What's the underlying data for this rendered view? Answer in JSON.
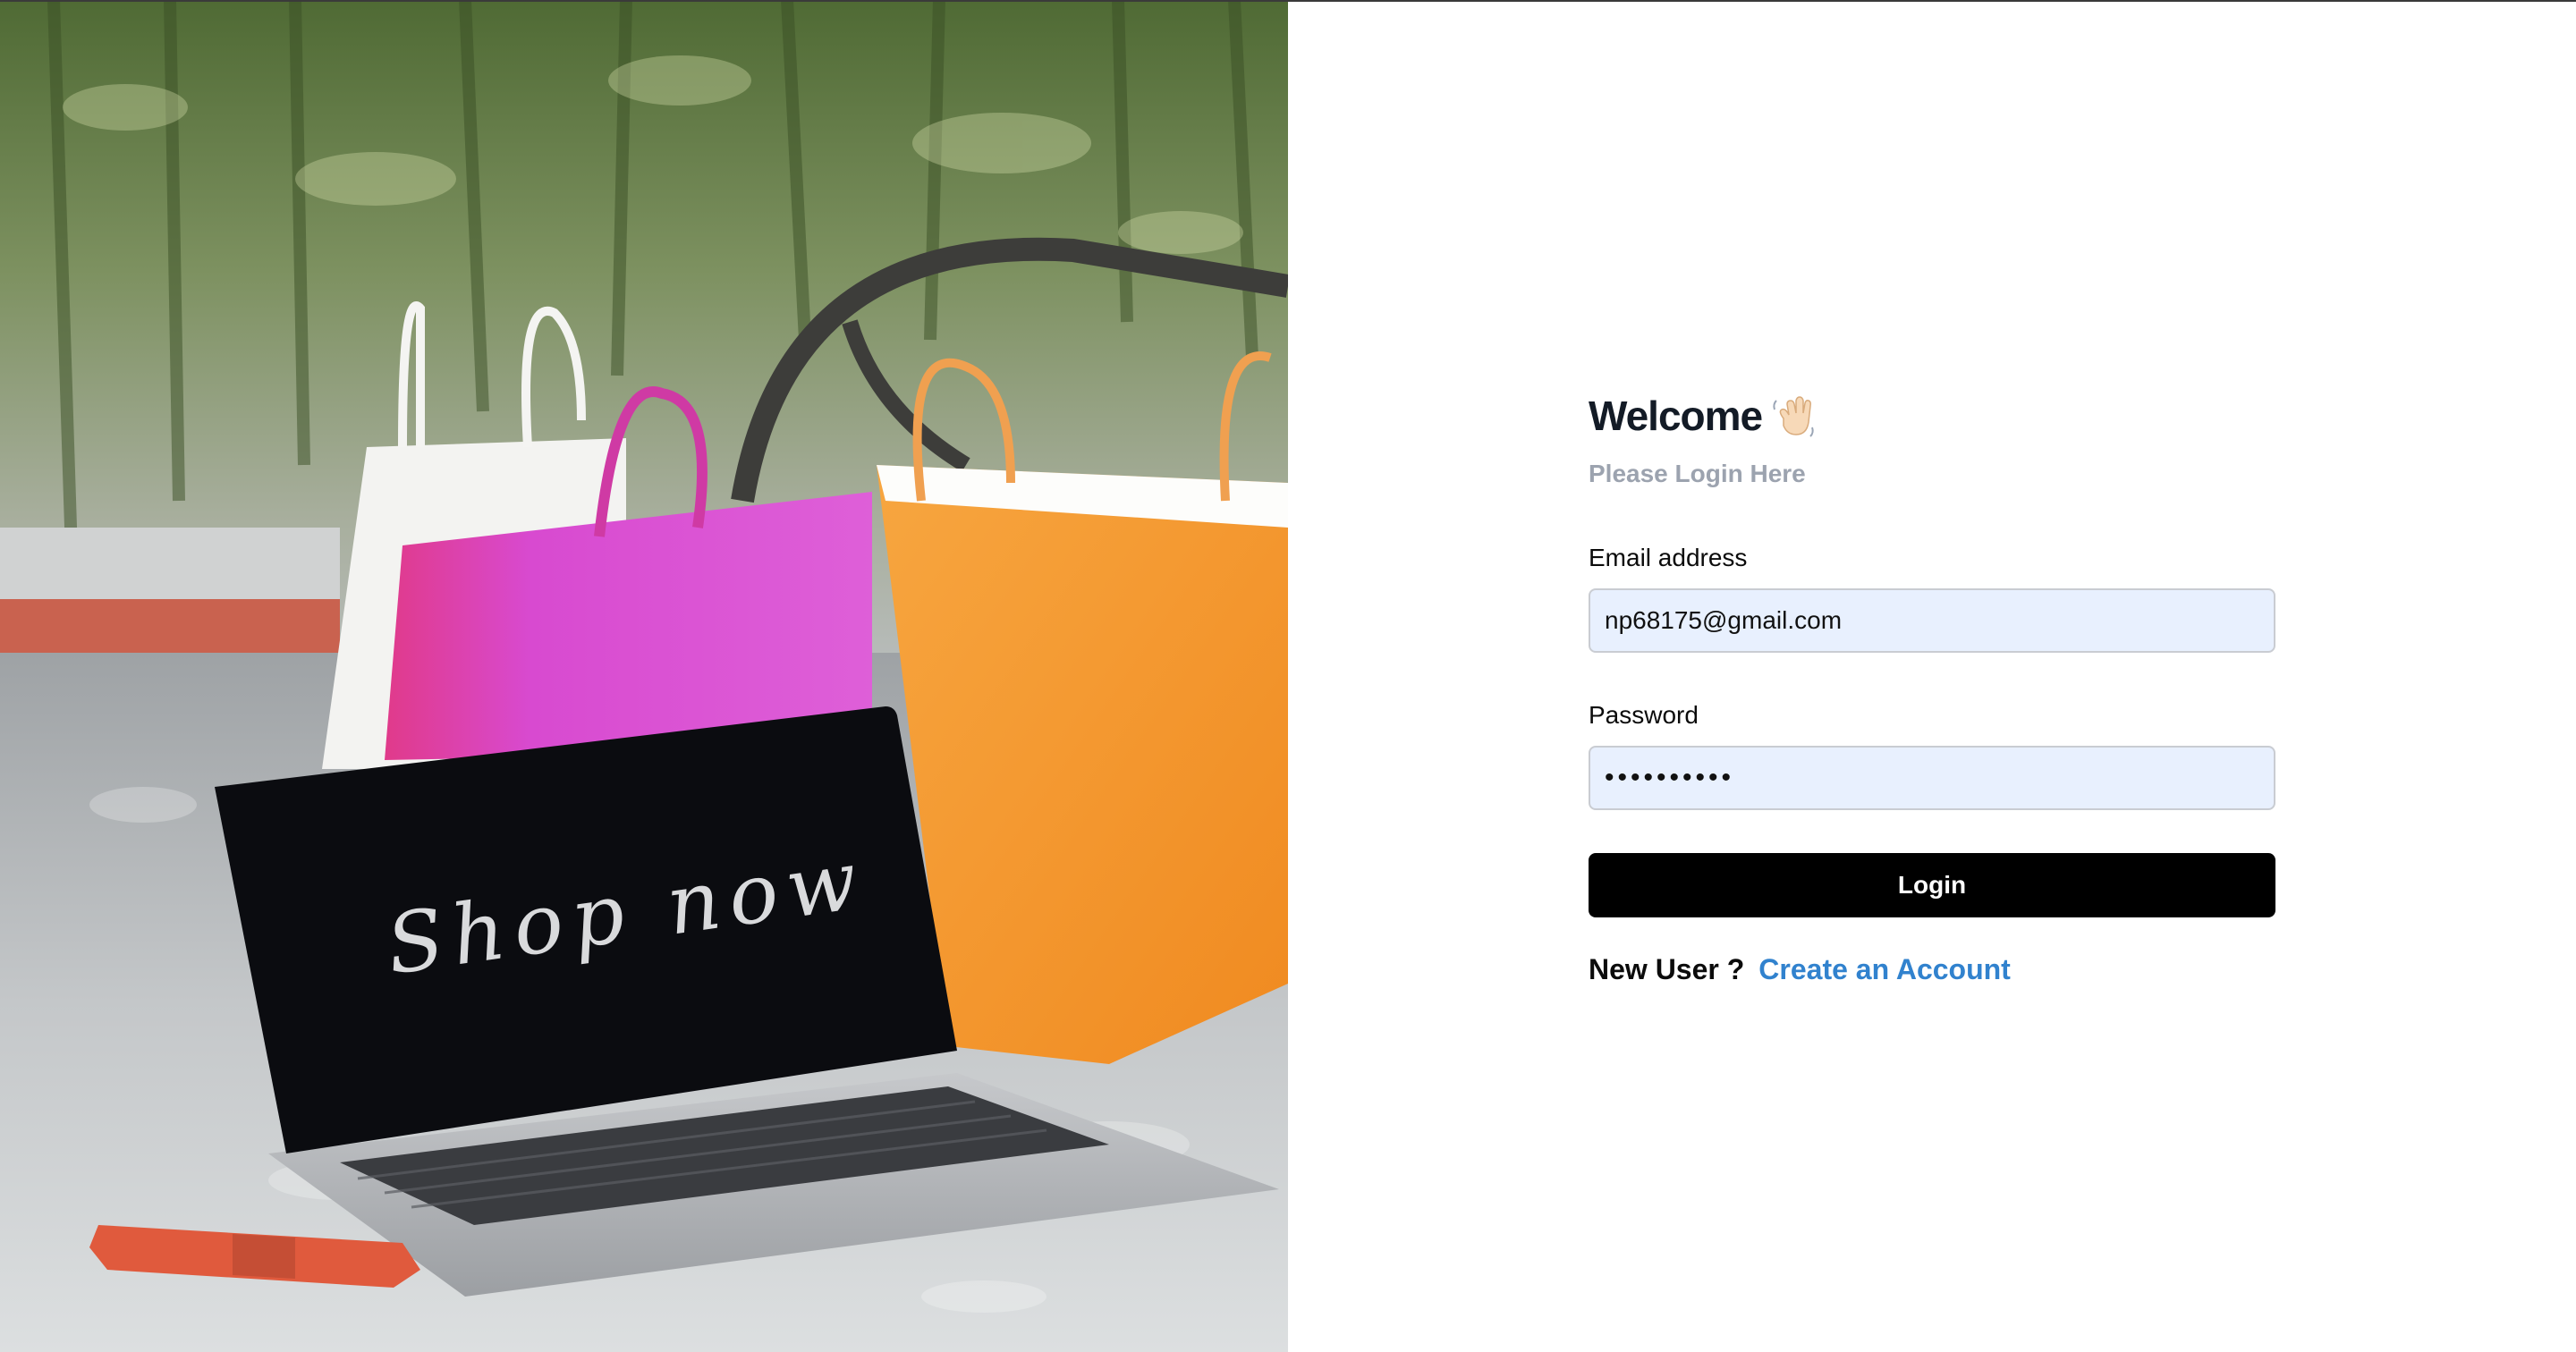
{
  "hero_image": {
    "screen_text": "Shop now",
    "icon": "shopping-bags-laptop-photo"
  },
  "login": {
    "title": "Welcome",
    "title_icon": "waving-hand-icon",
    "subtitle": "Please Login Here",
    "email_label": "Email address",
    "email_value": "np68175@gmail.com",
    "password_label": "Password",
    "password_value": "••••••••••",
    "login_button": "Login",
    "new_user_text": "New User ?",
    "create_account_link": "Create an Account"
  },
  "colors": {
    "title": "#131b26",
    "subtitle": "#9ca3af",
    "input_background": "#e8f0fe",
    "button_background": "#000000",
    "link": "#3182ce"
  }
}
